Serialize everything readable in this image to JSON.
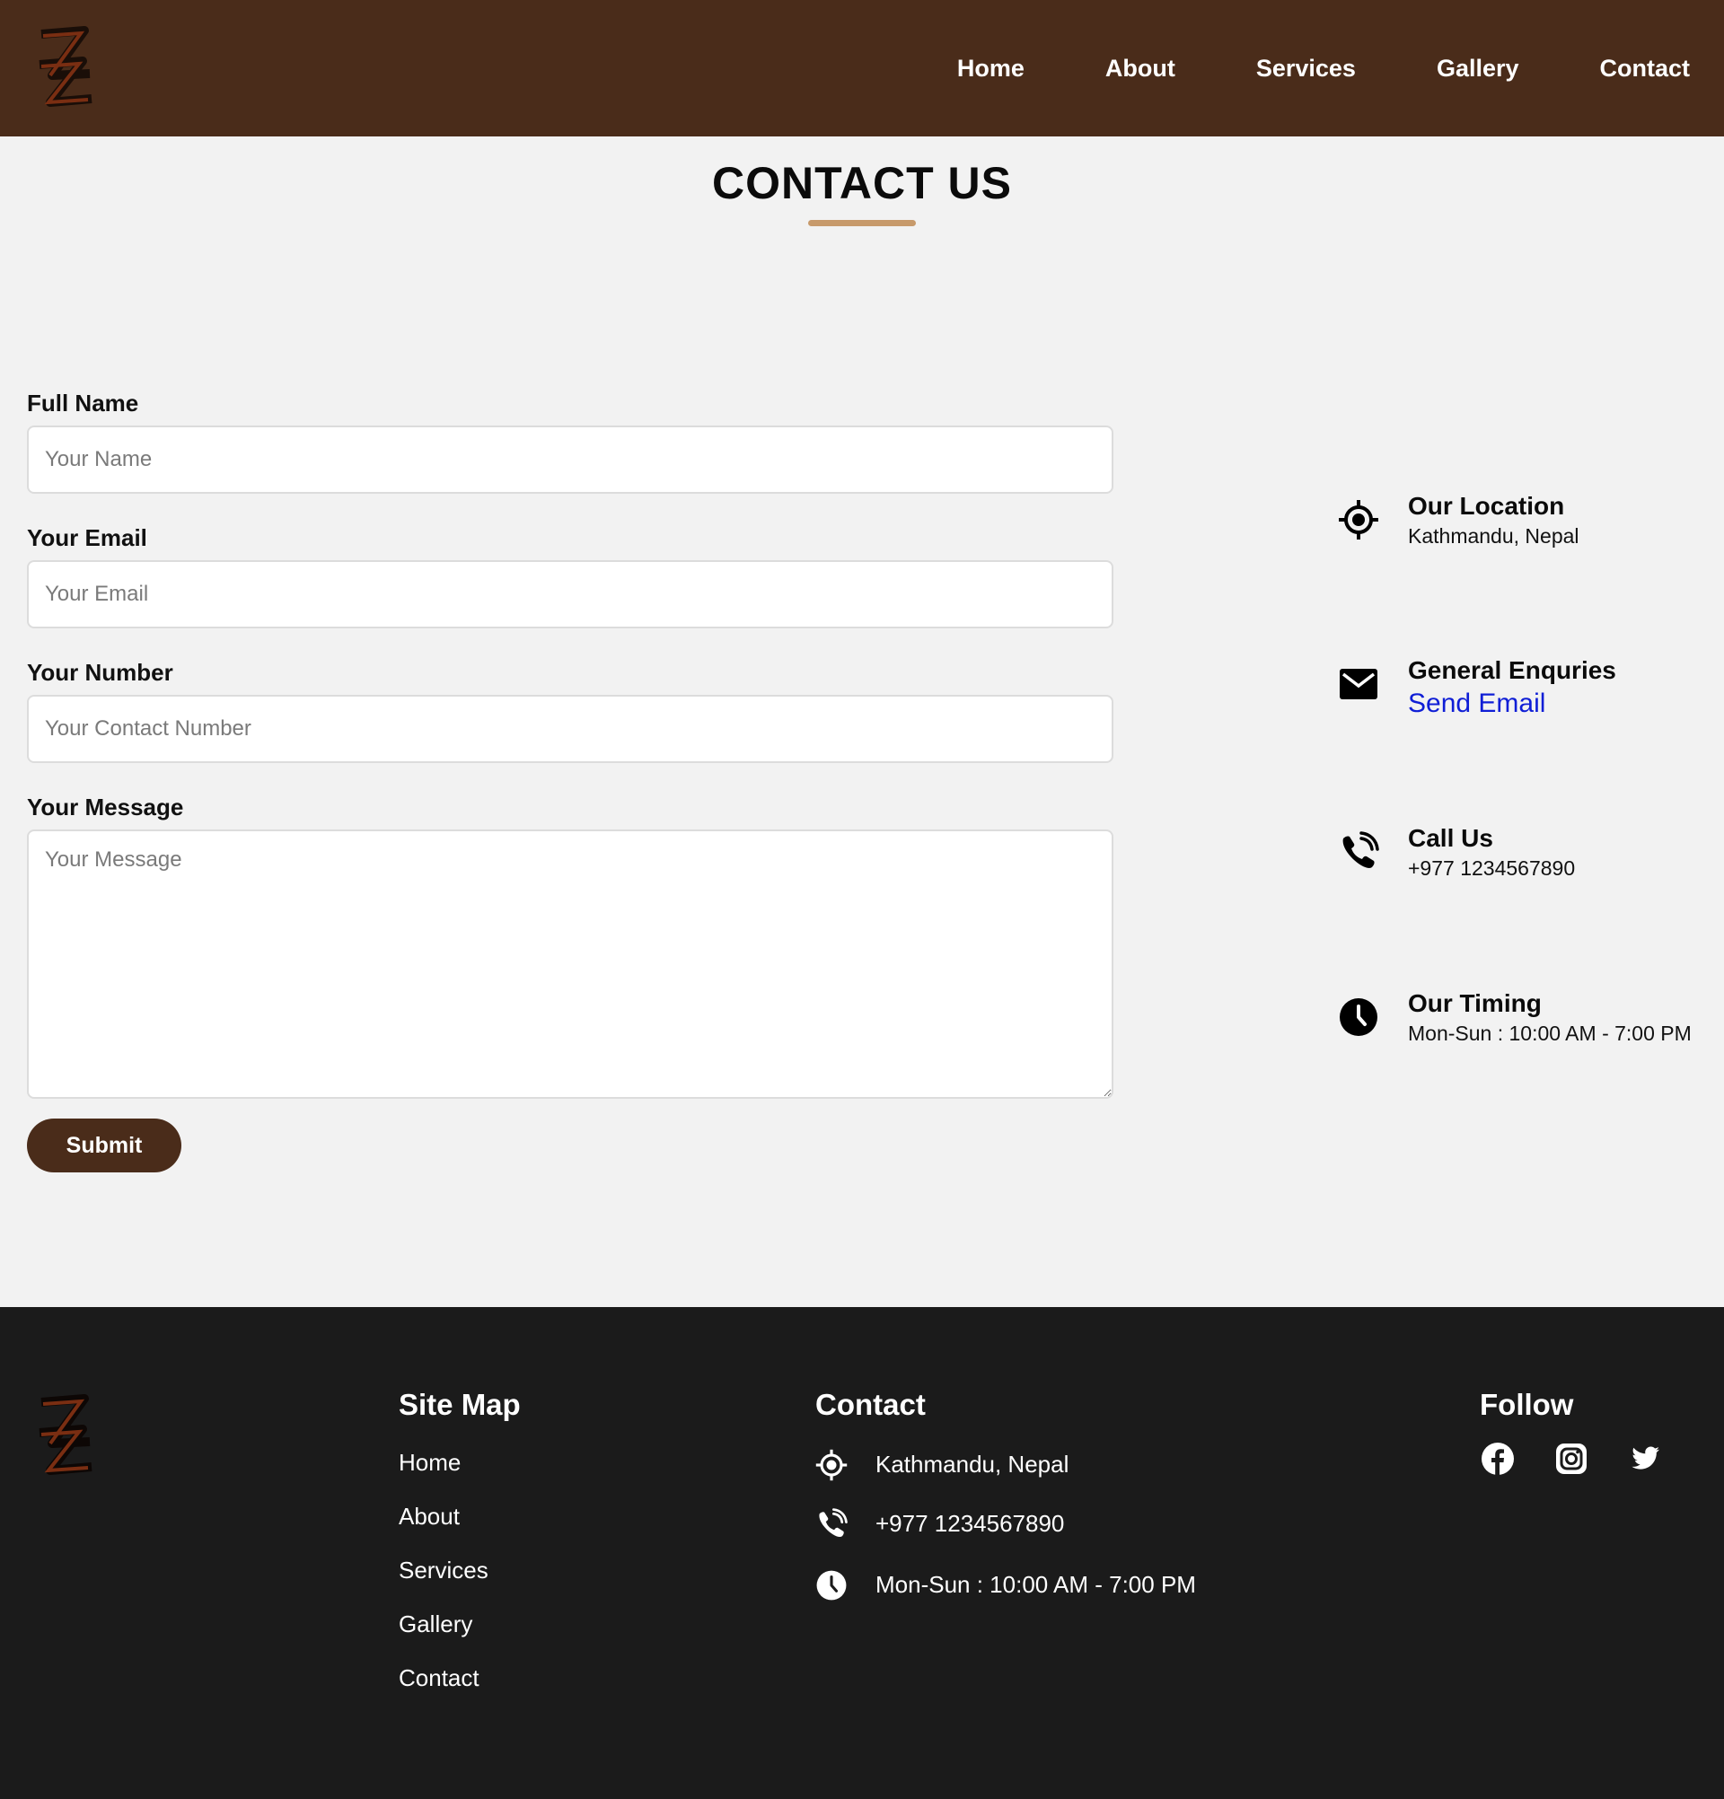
{
  "brand": {
    "logo_name": "Z logo",
    "primary_color": "#4a2c1a",
    "accent_color": "#c79a6b",
    "footer_color": "#1b1b1b",
    "link_color": "#0f1ed6"
  },
  "nav": {
    "items": [
      "Home",
      "About",
      "Services",
      "Gallery",
      "Contact"
    ]
  },
  "page": {
    "title": "CONTACT US"
  },
  "form": {
    "name_label": "Full Name",
    "name_placeholder": "Your Name",
    "email_label": "Your Email",
    "email_placeholder": "Your Email",
    "number_label": "Your Number",
    "number_placeholder": "Your Contact Number",
    "message_label": "Your Message",
    "message_placeholder": "Your Message",
    "submit_label": "Submit"
  },
  "info": {
    "location": {
      "icon": "location-crosshair-icon",
      "title": "Our Location",
      "text": "Kathmandu, Nepal"
    },
    "enquiries": {
      "icon": "envelope-icon",
      "title": "General Enquries",
      "link": "Send Email"
    },
    "call": {
      "icon": "phone-icon",
      "title": "Call Us",
      "text": "+977 1234567890"
    },
    "timing": {
      "icon": "clock-icon",
      "title": "Our Timing",
      "text": "Mon-Sun : 10:00 AM - 7:00 PM"
    }
  },
  "footer": {
    "sitemap_heading": "Site Map",
    "sitemap_links": [
      "Home",
      "About",
      "Services",
      "Gallery",
      "Contact"
    ],
    "contact_heading": "Contact",
    "contact_items": [
      "Kathmandu, Nepal",
      "+977 1234567890",
      "Mon-Sun : 10:00 AM - 7:00 PM"
    ],
    "follow_heading": "Follow",
    "social": [
      "facebook-icon",
      "instagram-icon",
      "twitter-icon"
    ]
  }
}
